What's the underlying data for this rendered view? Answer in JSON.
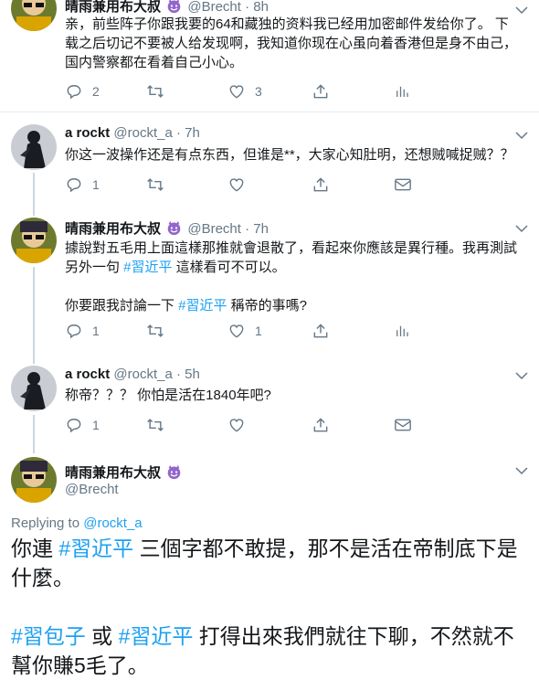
{
  "tweets": [
    {
      "name": "晴雨兼用布大叔",
      "handle": "@Brecht",
      "time": "8h",
      "body": "亲，前些阵子你跟我要的64和藏独的资料我已经用加密邮件发给你了。 下载之后切记不要被人给发现啊，我知道你现在心虽向着香港但是身不由己，国内警察都在看着自己小心。",
      "reply_count": "2",
      "retweet_count": "",
      "like_count": "3"
    },
    {
      "name": "a rockt",
      "handle": "@rockt_a",
      "time": "7h",
      "body": "你这一波操作还是有点东西，但谁是**，大家心知肚明，还想贼喊捉贼？？",
      "reply_count": "1",
      "retweet_count": "",
      "like_count": ""
    },
    {
      "name": "晴雨兼用布大叔",
      "handle": "@Brecht",
      "time": "7h",
      "body_line1": "據說對五毛用上面這樣那推就會退散了，看起來你應該是異行種。我再測試",
      "body_line2_pre": "另外一句 ",
      "body_line2_tag": "#習近平",
      "body_line2_post": " 這樣看可不可以。",
      "body_line3_pre": "你要跟我討論一下 ",
      "body_line3_tag": "#習近平",
      "body_line3_post": " 稱帝的事嗎?",
      "reply_count": "1",
      "retweet_count": "",
      "like_count": "1"
    },
    {
      "name": "a rockt",
      "handle": "@rockt_a",
      "time": "5h",
      "body": "称帝？？？ 你怕是活在1840年吧?",
      "reply_count": "1",
      "retweet_count": "",
      "like_count": ""
    }
  ],
  "main_tweet": {
    "name": "晴雨兼用布大叔",
    "handle": "@Brecht",
    "replying_label": "Replying to",
    "replying_to": "@rockt_a",
    "line1_pre": "你連 ",
    "line1_tag": "#習近平",
    "line1_post": " 三個字都不敢提，那不是活在帝制底下是",
    "line2": "什麼。",
    "line3_tag1": "#習包子",
    "line3_mid": " 或 ",
    "line3_tag2": "#習近平",
    "line3_post": " 打得出來我們就往下聊，不然就不",
    "line4": "幫你賺5毛了。"
  },
  "separator": " · ",
  "colors": {
    "accent": "#1da1f2",
    "secondary": "#657786",
    "border": "#e6ecf0",
    "text": "#14171a"
  },
  "icons": [
    "reply-icon",
    "retweet-icon",
    "like-icon",
    "share-icon",
    "analytics-icon",
    "chevron-down-icon",
    "devil-emoji-icon"
  ]
}
